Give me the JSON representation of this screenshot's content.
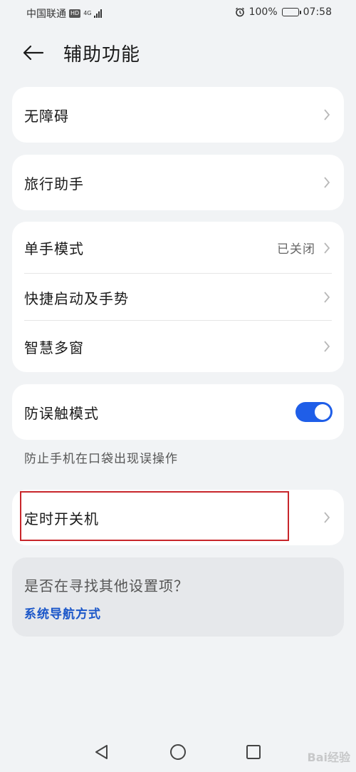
{
  "status_bar": {
    "carrier": "中国联通",
    "hd": "HD",
    "network": "4G",
    "battery": "100%",
    "time": "07:58"
  },
  "header": {
    "title": "辅助功能"
  },
  "cards": {
    "accessibility": {
      "label": "无障碍"
    },
    "travel": {
      "label": "旅行助手"
    },
    "one_hand": {
      "label": "单手模式",
      "value": "已关闭"
    },
    "shortcuts": {
      "label": "快捷启动及手势"
    },
    "multi_window": {
      "label": "智慧多窗"
    },
    "pocket_mode": {
      "label": "防误触模式",
      "enabled": true,
      "hint": "防止手机在口袋出现误操作"
    },
    "scheduled_power": {
      "label": "定时开关机"
    }
  },
  "suggestion": {
    "question": "是否在寻找其他设置项？",
    "link": "系统导航方式"
  },
  "colors": {
    "background": "#f1f3f5",
    "accent": "#1f5ee8",
    "link": "#1a56c9",
    "highlight": "#c8262b"
  },
  "watermark": "Bai经验"
}
